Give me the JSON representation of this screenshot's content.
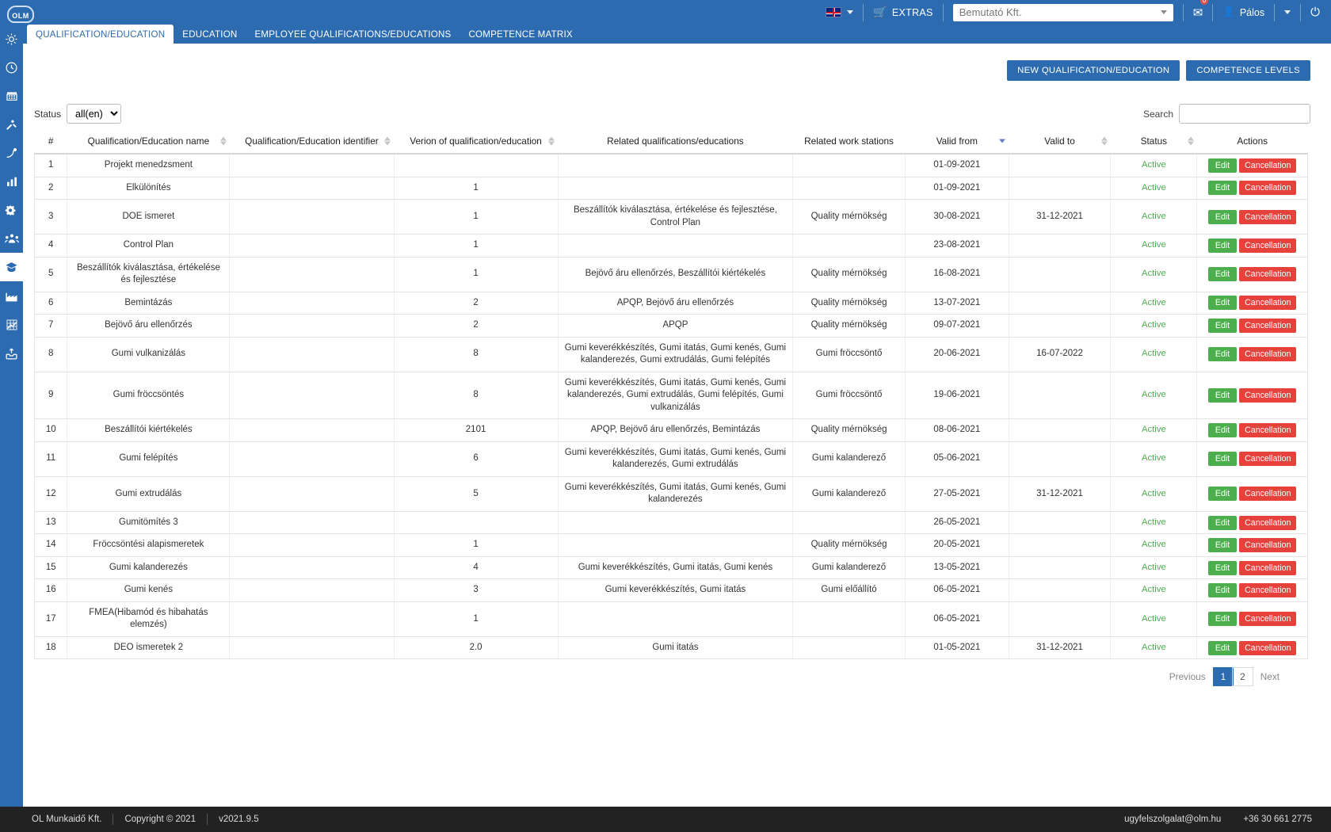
{
  "brand": {
    "logo_text": "OLM",
    "accent": "#2d6bb0"
  },
  "topbar": {
    "language_icon": "uk-flag-icon",
    "extras_label": "EXTRAS",
    "cart_icon": "cart-icon",
    "company_value": "Bemutató Kft.",
    "mail_badge": "0",
    "user_name": "Pálos",
    "power_icon": "power-icon"
  },
  "tabs": [
    {
      "label": "QUALIFICATION/EDUCATION",
      "active": true
    },
    {
      "label": "EDUCATION",
      "active": false
    },
    {
      "label": "EMPLOYEE QUALIFICATIONS/EDUCATIONS",
      "active": false
    },
    {
      "label": "COMPETENCE MATRIX",
      "active": false
    }
  ],
  "sidebar": {
    "items": [
      {
        "name": "sun-icon"
      },
      {
        "name": "clock-icon"
      },
      {
        "name": "calendar-icon"
      },
      {
        "name": "tools-icon"
      },
      {
        "name": "satellite-icon"
      },
      {
        "name": "bar-chart-icon"
      },
      {
        "name": "gear-icon"
      },
      {
        "name": "users-icon"
      },
      {
        "name": "graduation-icon",
        "active": true
      },
      {
        "name": "factory-icon"
      },
      {
        "name": "grid-chart-icon"
      },
      {
        "name": "inbox-upload-icon"
      }
    ]
  },
  "toolbar": {
    "new_qualification_label": "NEW QUALIFICATION/EDUCATION",
    "competence_levels_label": "COMPETENCE LEVELS"
  },
  "filters": {
    "status_label": "Status",
    "status_value": "all(en)",
    "status_options": [
      "all(en)"
    ],
    "search_label": "Search",
    "search_value": "",
    "search_placeholder": ""
  },
  "table": {
    "columns": [
      {
        "label": "#",
        "sortable": false
      },
      {
        "label": "Qualification/Education name",
        "sortable": true
      },
      {
        "label": "Qualification/Education identifier",
        "sortable": true
      },
      {
        "label": "Verion of qualification/education",
        "sortable": true
      },
      {
        "label": "Related qualifications/educations",
        "sortable": false
      },
      {
        "label": "Related work stations",
        "sortable": false
      },
      {
        "label": "Valid from",
        "sortable": true,
        "sorted": "desc"
      },
      {
        "label": "Valid to",
        "sortable": true
      },
      {
        "label": "Status",
        "sortable": true
      },
      {
        "label": "Actions",
        "sortable": false
      }
    ],
    "rows": [
      {
        "num": "1",
        "name": "Projekt menedzsment",
        "identifier": "",
        "version": "",
        "related_quals": "",
        "work_stations": "",
        "valid_from": "01-09-2021",
        "valid_to": "",
        "status": "Active"
      },
      {
        "num": "2",
        "name": "Elkülönítés",
        "identifier": "",
        "version": "1",
        "related_quals": "",
        "work_stations": "",
        "valid_from": "01-09-2021",
        "valid_to": "",
        "status": "Active"
      },
      {
        "num": "3",
        "name": "DOE ismeret",
        "identifier": "",
        "version": "1",
        "related_quals": "Beszállítók kiválasztása, értékelése és fejlesztése, Control Plan",
        "work_stations": "Quality mérnökség",
        "valid_from": "30-08-2021",
        "valid_to": "31-12-2021",
        "status": "Active"
      },
      {
        "num": "4",
        "name": "Control Plan",
        "identifier": "",
        "version": "1",
        "related_quals": "",
        "work_stations": "",
        "valid_from": "23-08-2021",
        "valid_to": "",
        "status": "Active"
      },
      {
        "num": "5",
        "name": "Beszállítók kiválasztása, értékelése és fejlesztése",
        "identifier": "",
        "version": "1",
        "related_quals": "Bejövő áru ellenőrzés, Beszállítói kiértékelés",
        "work_stations": "Quality mérnökség",
        "valid_from": "16-08-2021",
        "valid_to": "",
        "status": "Active"
      },
      {
        "num": "6",
        "name": "Bemintázás",
        "identifier": "",
        "version": "2",
        "related_quals": "APQP, Bejövő áru ellenőrzés",
        "work_stations": "Quality mérnökség",
        "valid_from": "13-07-2021",
        "valid_to": "",
        "status": "Active"
      },
      {
        "num": "7",
        "name": "Bejövő áru ellenőrzés",
        "identifier": "",
        "version": "2",
        "related_quals": "APQP",
        "work_stations": "Quality mérnökség",
        "valid_from": "09-07-2021",
        "valid_to": "",
        "status": "Active"
      },
      {
        "num": "8",
        "name": "Gumi vulkanizálás",
        "identifier": "",
        "version": "8",
        "related_quals": "Gumi keverékkészítés, Gumi itatás, Gumi kenés, Gumi kalanderezés, Gumi extrudálás, Gumi felépítés",
        "work_stations": "Gumi fröccsöntő",
        "valid_from": "20-06-2021",
        "valid_to": "16-07-2022",
        "status": "Active"
      },
      {
        "num": "9",
        "name": "Gumi fröccsöntés",
        "identifier": "",
        "version": "8",
        "related_quals": "Gumi keverékkészítés, Gumi itatás, Gumi kenés, Gumi kalanderezés, Gumi extrudálás, Gumi felépítés, Gumi vulkanizálás",
        "work_stations": "Gumi fröccsöntő",
        "valid_from": "19-06-2021",
        "valid_to": "",
        "status": "Active"
      },
      {
        "num": "10",
        "name": "Beszállítói kiértékelés",
        "identifier": "",
        "version": "2101",
        "related_quals": "APQP, Bejövő áru ellenőrzés, Bemintázás",
        "work_stations": "Quality mérnökség",
        "valid_from": "08-06-2021",
        "valid_to": "",
        "status": "Active"
      },
      {
        "num": "11",
        "name": "Gumi felépítés",
        "identifier": "",
        "version": "6",
        "related_quals": "Gumi keverékkészítés, Gumi itatás, Gumi kenés, Gumi kalanderezés, Gumi extrudálás",
        "work_stations": "Gumi kalanderező",
        "valid_from": "05-06-2021",
        "valid_to": "",
        "status": "Active"
      },
      {
        "num": "12",
        "name": "Gumi extrudálás",
        "identifier": "",
        "version": "5",
        "related_quals": "Gumi keverékkészítés, Gumi itatás, Gumi kenés, Gumi kalanderezés",
        "work_stations": "Gumi kalanderező",
        "valid_from": "27-05-2021",
        "valid_to": "31-12-2021",
        "status": "Active"
      },
      {
        "num": "13",
        "name": "Gumitömítés 3",
        "identifier": "",
        "version": "",
        "related_quals": "",
        "work_stations": "",
        "valid_from": "26-05-2021",
        "valid_to": "",
        "status": "Active"
      },
      {
        "num": "14",
        "name": "Fröccsöntési alapismeretek",
        "identifier": "",
        "version": "1",
        "related_quals": "",
        "work_stations": "Quality mérnökség",
        "valid_from": "20-05-2021",
        "valid_to": "",
        "status": "Active"
      },
      {
        "num": "15",
        "name": "Gumi kalanderezés",
        "identifier": "",
        "version": "4",
        "related_quals": "Gumi keverékkészítés, Gumi itatás, Gumi kenés",
        "work_stations": "Gumi kalanderező",
        "valid_from": "13-05-2021",
        "valid_to": "",
        "status": "Active"
      },
      {
        "num": "16",
        "name": "Gumi kenés",
        "identifier": "",
        "version": "3",
        "related_quals": "Gumi keverékkészítés, Gumi itatás",
        "work_stations": "Gumi előállító",
        "valid_from": "06-05-2021",
        "valid_to": "",
        "status": "Active"
      },
      {
        "num": "17",
        "name": "FMEA(Hibamód és hibahatás elemzés)",
        "identifier": "",
        "version": "1",
        "related_quals": "",
        "work_stations": "",
        "valid_from": "06-05-2021",
        "valid_to": "",
        "status": "Active"
      },
      {
        "num": "18",
        "name": "DEO ismeretek 2",
        "identifier": "",
        "version": "2.0",
        "related_quals": "Gumi itatás",
        "work_stations": "",
        "valid_from": "01-05-2021",
        "valid_to": "31-12-2021",
        "status": "Active"
      }
    ],
    "row_actions": {
      "edit_label": "Edit",
      "cancel_label": "Cancellation"
    }
  },
  "pagination": {
    "previous_label": "Previous",
    "pages": [
      "1",
      "2"
    ],
    "active_page": "1",
    "next_label": "Next"
  },
  "footer": {
    "company": "OL Munkaidő Kft.",
    "copyright": "Copyright © 2021",
    "version": "v2021.9.5",
    "email": "ugyfelszolgalat@olm.hu",
    "phone": "+36 30 661 2775"
  }
}
